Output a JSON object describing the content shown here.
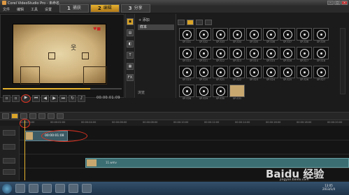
{
  "window": {
    "title": "Corel VideoStudio Pro - 未命名"
  },
  "menu": [
    "文件",
    "编辑",
    "工具",
    "设置"
  ],
  "steps": [
    {
      "n": "1",
      "label": "捕获"
    },
    {
      "n": "2",
      "label": "编辑"
    },
    {
      "n": "3",
      "label": "分享"
    }
  ],
  "library": {
    "add_label": "添加",
    "selected_folder": "样本",
    "browse_label": "浏览",
    "items": [
      "SP-S01",
      "SP-S02",
      "SP-S03",
      "SP-S04",
      "SP-S05",
      "SP-S06",
      "SP-S07",
      "SP-S08",
      "SP-S09",
      "SP-S10",
      "SP-S11",
      "SP-S12",
      "SP-S13",
      "SP-S14",
      "SP-S15",
      "SP-S16",
      "SP-S17",
      "SP-S18",
      "SP-S19",
      "SP-S20",
      "SP-S21",
      "SP-S22",
      "SP-S23",
      "SP-S24",
      "SP-S25",
      "SP-S26",
      "SP-S27",
      "SP-S28",
      "SP-S29",
      "SP-S30",
      "SP-S31"
    ]
  },
  "preview": {
    "timecode": "00:00:01:09"
  },
  "timeline": {
    "clip1_timecode": "00:00:01:08",
    "clip2_label": "11.wmv",
    "ruler": [
      "00:00:00:00",
      "00:00:02:00",
      "00:00:04:00",
      "00:00:06:00",
      "00:00:08:00",
      "00:00:10:00",
      "00:00:12:00",
      "00:00:14:00",
      "00:00:16:00",
      "00:00:18:00",
      "00:00:20:00"
    ]
  },
  "taskbar": {
    "time": "13:05",
    "date": "2013/1/4"
  },
  "watermark": {
    "brand": "Baidu 经验",
    "url": "jingyan.baidu.com"
  },
  "colors": {
    "accent": "#e6b330",
    "highlight_ring": "#d32222"
  }
}
